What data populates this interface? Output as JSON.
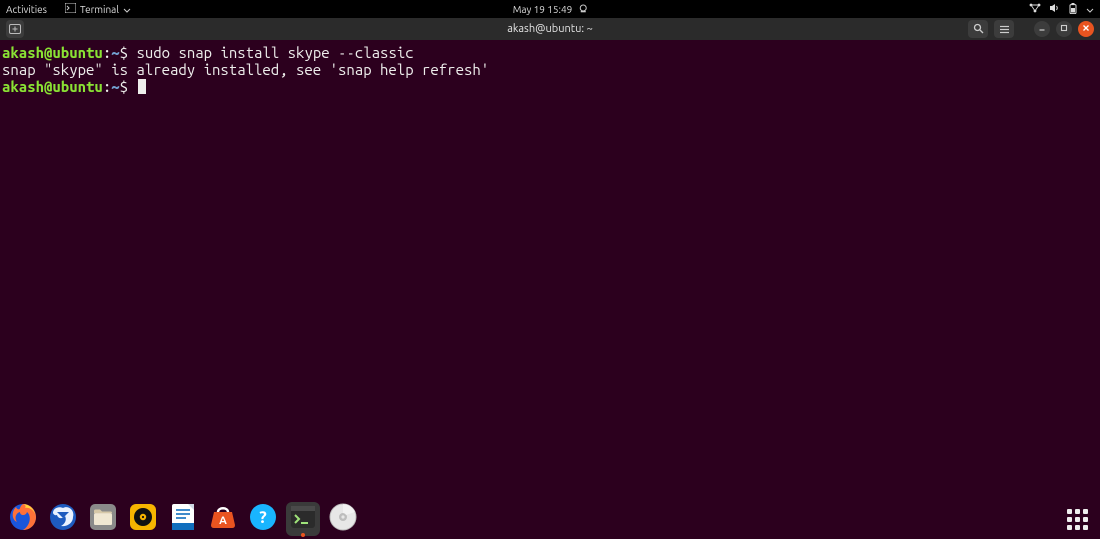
{
  "topbar": {
    "activities": "Activities",
    "app_label": "Terminal",
    "datetime": "May 19  15:49"
  },
  "window": {
    "title": "akash@ubuntu: ~"
  },
  "terminal": {
    "lines": [
      {
        "user": "akash@ubuntu",
        "path": "~",
        "cmd": "sudo snap install skype --classic"
      },
      {
        "output": "snap \"skype\" is already installed, see 'snap help refresh'"
      },
      {
        "user": "akash@ubuntu",
        "path": "~",
        "cmd": "",
        "cursor": true
      }
    ]
  },
  "dock": {
    "apps": [
      "firefox",
      "thunderbird",
      "files",
      "rhythmbox",
      "libreoffice-writer",
      "software",
      "help",
      "terminal",
      "disc"
    ],
    "active": "terminal"
  }
}
